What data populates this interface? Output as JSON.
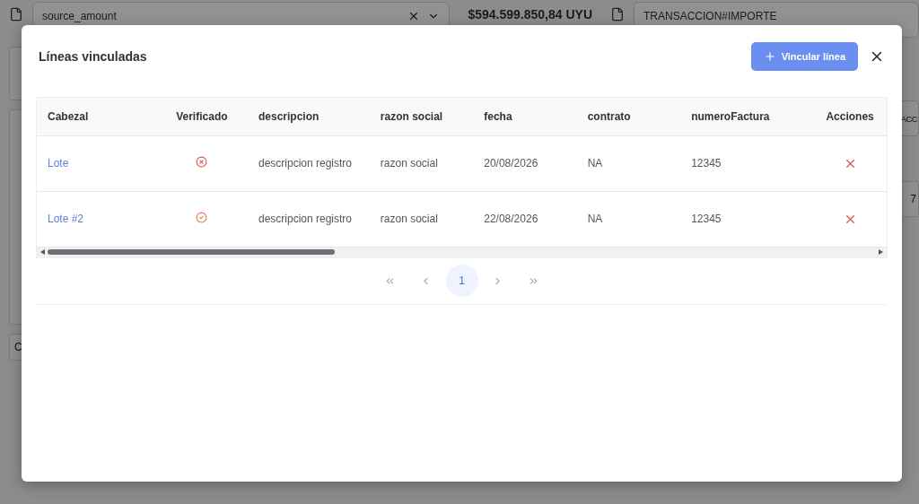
{
  "background": {
    "source_field": {
      "value": "source_amount"
    },
    "amount": "$594.599.850,84 UYU",
    "target_field": {
      "value": "TRANSACCION#IMPORTE"
    },
    "left_label": "C",
    "right_label": "ACC",
    "right_number": "7"
  },
  "dialog": {
    "title": "Líneas vinculadas",
    "add_button": "Vincular línea",
    "table": {
      "columns": [
        "Cabezal",
        "Verificado",
        "descripcion",
        "razon social",
        "fecha",
        "contrato",
        "numeroFactura",
        "Acciones"
      ],
      "rows": [
        {
          "cabezal": "Lote",
          "verified": false,
          "descripcion": "descripcion registro",
          "razon_social": "razon social",
          "fecha": "20/08/2026",
          "contrato": "NA",
          "numero_factura": "12345"
        },
        {
          "cabezal": "Lote #2",
          "verified": true,
          "descripcion": "descripcion registro",
          "razon_social": "razon social",
          "fecha": "22/08/2026",
          "contrato": "NA",
          "numero_factura": "12345"
        }
      ]
    },
    "pagination": {
      "pages": [
        {
          "label": "1",
          "selected": true
        }
      ]
    }
  }
}
